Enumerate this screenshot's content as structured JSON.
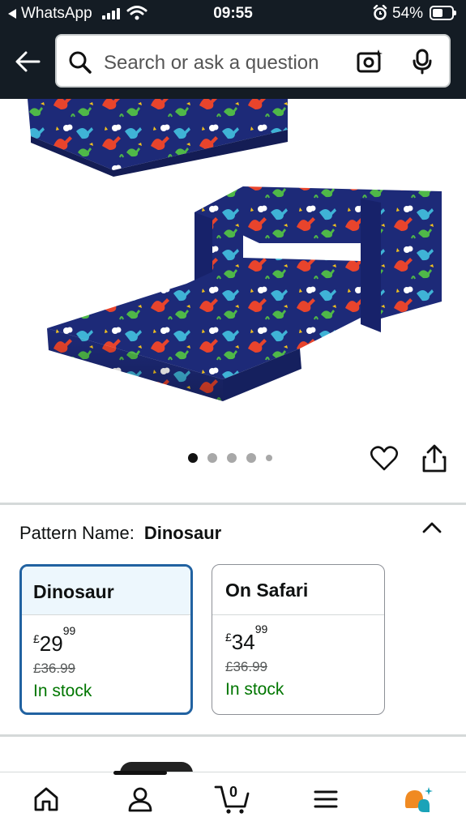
{
  "status_bar": {
    "back_app": "WhatsApp",
    "time": "09:55",
    "battery": "54%"
  },
  "header": {
    "search_placeholder": "Search or ask a question"
  },
  "gallery": {
    "image_alt": "Children's fold-out flip sofa with dinosaur print",
    "dot_count": 5,
    "active_dot": 0
  },
  "variation": {
    "label": "Pattern Name:",
    "value": "Dinosaur",
    "options": [
      {
        "name": "Dinosaur",
        "currency": "£",
        "price_whole": "29",
        "price_fraction": "99",
        "was": "£36.99",
        "stock": "In stock",
        "selected": true
      },
      {
        "name": "On Safari",
        "currency": "£",
        "price_whole": "34",
        "price_fraction": "99",
        "was": "£36.99",
        "stock": "In stock",
        "selected": false
      }
    ]
  },
  "tabbar": {
    "cart_count": "0",
    "tabs": [
      "home-icon",
      "account-icon",
      "cart-icon",
      "menu-icon",
      "rufus-icon"
    ]
  },
  "colors": {
    "header_bg": "#141c24",
    "selected_border": "#2162a1",
    "in_stock": "#007600",
    "rufus_orange": "#f08a22",
    "rufus_teal": "#1aa3b8"
  }
}
